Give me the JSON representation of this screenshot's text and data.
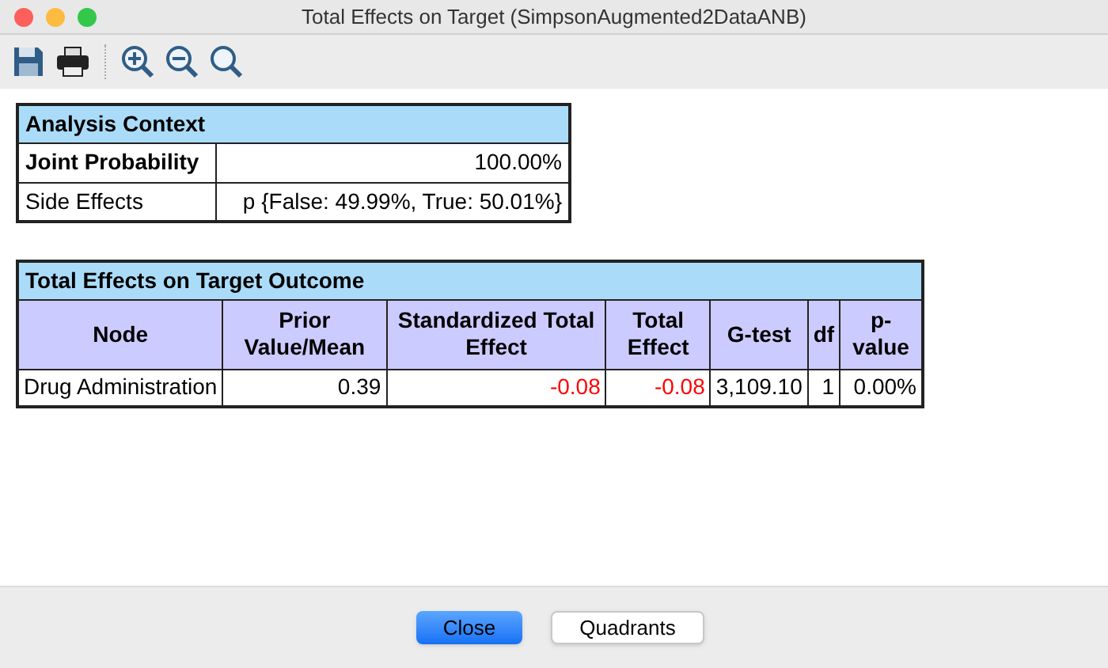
{
  "window": {
    "title": "Total Effects on Target (SimpsonAugmented2DataANB)"
  },
  "toolbar": [
    {
      "kind": "save"
    },
    {
      "kind": "print"
    },
    {
      "kind": "zoom-in"
    },
    {
      "kind": "zoom-out"
    },
    {
      "kind": "zoom-fit"
    }
  ],
  "context_table": {
    "title": "Analysis Context",
    "rows": [
      {
        "label": "Joint Probability",
        "value": "100.00%",
        "bold": true
      },
      {
        "label": "Side Effects",
        "value": "p {False: 49.99%, True: 50.01%}",
        "bold": false
      }
    ]
  },
  "effects_table": {
    "title": "Total Effects on Target Outcome",
    "columns": [
      "Node",
      "Prior Value/Mean",
      "Standardized Total Effect",
      "Total Effect",
      "G-test",
      "df",
      "p-value"
    ],
    "rows": [
      [
        {
          "text": "Drug Administration",
          "color": "#000000"
        },
        {
          "text": "0.39",
          "color": "#000000"
        },
        {
          "text": "-0.08",
          "color": "#ff0000"
        },
        {
          "text": "-0.08",
          "color": "#ff0000"
        },
        {
          "text": "3,109.10",
          "color": "#000000"
        },
        {
          "text": "1",
          "color": "#000000"
        },
        {
          "text": "0.00%",
          "color": "#000000"
        }
      ]
    ]
  },
  "buttons": [
    {
      "label": "Close",
      "default": true
    },
    {
      "label": "Quadrants",
      "default": false
    }
  ]
}
